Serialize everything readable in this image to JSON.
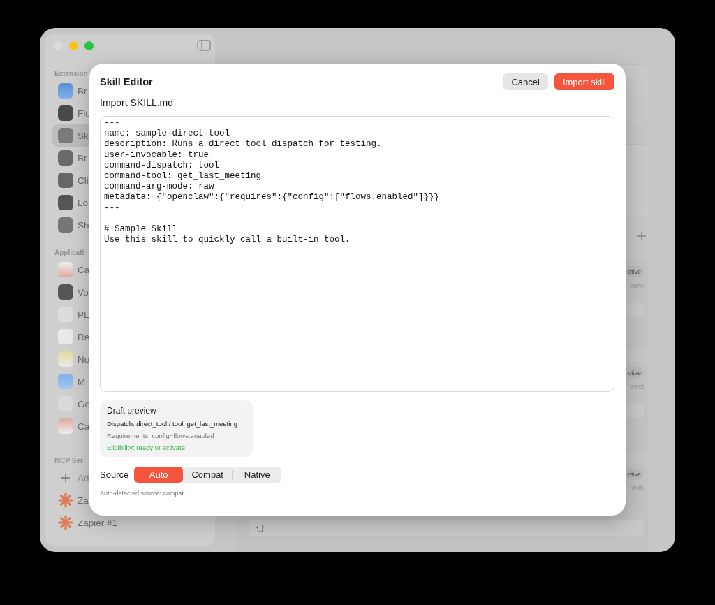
{
  "sidebar": {
    "sections": [
      {
        "label": "Extension",
        "items": [
          {
            "label": "Br",
            "selected": false
          },
          {
            "label": "Flo",
            "selected": false
          },
          {
            "label": "Sk",
            "selected": true
          },
          {
            "label": "Br",
            "selected": false
          },
          {
            "label": "Cli",
            "selected": false
          },
          {
            "label": "Lo",
            "selected": false
          },
          {
            "label": "Sh",
            "selected": false
          }
        ]
      },
      {
        "label": "Applicati",
        "items": [
          {
            "label": "Ca",
            "selected": false
          },
          {
            "label": "Vo",
            "selected": false
          },
          {
            "label": "PL",
            "selected": false
          },
          {
            "label": "Re",
            "selected": false
          },
          {
            "label": "No",
            "selected": false
          },
          {
            "label": "M",
            "selected": false
          },
          {
            "label": "Go",
            "selected": false
          },
          {
            "label": "Ca",
            "selected": false
          }
        ]
      },
      {
        "label": "MCP Ser",
        "add_label": "Ad",
        "items": [
          {
            "label": "Za",
            "selected": false
          },
          {
            "label": "Zapier #1",
            "selected": false
          }
        ]
      }
    ]
  },
  "main": {
    "cards": [
      {
        "badge": "ctive",
        "text": "new"
      },
      {
        "badge": "ctive",
        "text": "nect"
      },
      {
        "badge": "ctive",
        "text": "with",
        "json_value": "{}"
      }
    ]
  },
  "dialog": {
    "title": "Skill Editor",
    "buttons": [
      {
        "label": "Cancel",
        "kind": "secondary"
      },
      {
        "label": "Import skill",
        "kind": "primary"
      }
    ],
    "subtitle": "Import SKILL.md",
    "editor_text": "---\nname: sample-direct-tool\ndescription: Runs a direct tool dispatch for testing.\nuser-invocable: true\ncommand-dispatch: tool\ncommand-tool: get_last_meeting\ncommand-arg-mode: raw\nmetadata: {\"openclaw\":{\"requires\":{\"config\":[\"flows.enabled\"]}}}\n---\n\n# Sample Skill\nUse this skill to quickly call a built-in tool.",
    "preview": {
      "title": "Draft preview",
      "lines": [
        {
          "text": "Dispatch: direct_tool / tool: get_last_meeting",
          "kind": "primary"
        },
        {
          "text": "Requirements: config=flows.enabled",
          "kind": "muted"
        },
        {
          "text": "Eligibility: ready to activate",
          "kind": "success"
        }
      ]
    },
    "source": {
      "label": "Source",
      "options": [
        {
          "label": "Auto",
          "selected": true
        },
        {
          "label": "Compat",
          "selected": false
        },
        {
          "label": "Native",
          "selected": false
        }
      ],
      "note": "Auto-detected source: compat"
    }
  }
}
